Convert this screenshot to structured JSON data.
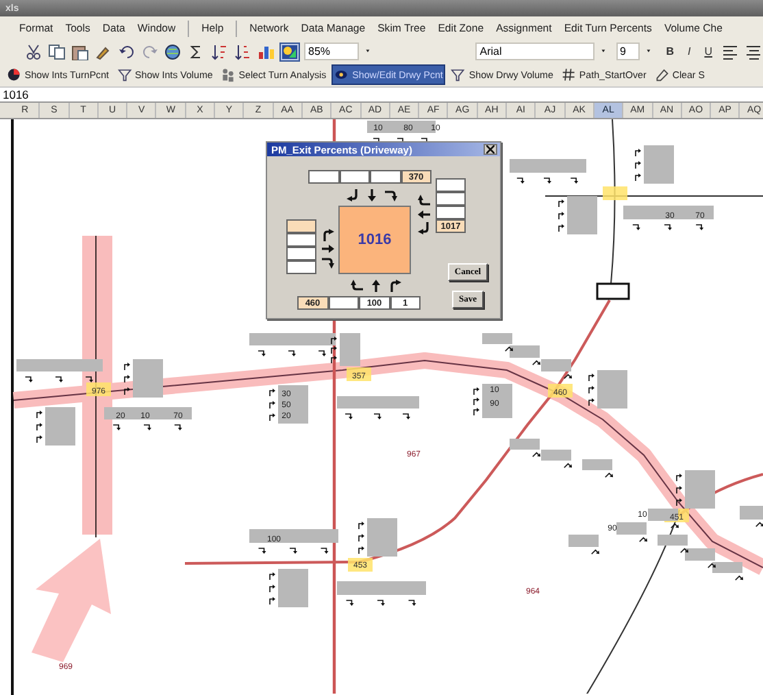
{
  "window": {
    "title": "xls"
  },
  "menu": [
    "Format",
    "Tools",
    "Data",
    "Window",
    "Help",
    "Network",
    "Data Manage",
    "Skim Tree",
    "Edit Zone",
    "Assignment",
    "Edit Turn Percents",
    "Volume Che"
  ],
  "toolbar": {
    "zoom": "85%",
    "font": "Arial",
    "font_size": "9",
    "format_buttons": [
      "B",
      "I",
      "U"
    ]
  },
  "custom_toolbar": [
    {
      "label": "Show Ints TurnPcnt",
      "selected": false
    },
    {
      "label": "Show Ints Volume",
      "selected": false
    },
    {
      "label": "Select Turn Analysis",
      "selected": false
    },
    {
      "label": "Show/Edit Drwy Pcnt",
      "selected": true
    },
    {
      "label": "Show Drwy Volume",
      "selected": false
    },
    {
      "label": "Path_StartOver",
      "selected": false
    },
    {
      "label": "Clear S",
      "selected": false
    }
  ],
  "formula_bar": {
    "value": "1016"
  },
  "columns": [
    {
      "label": "R",
      "selected": false
    },
    {
      "label": "S",
      "selected": false
    },
    {
      "label": "T",
      "selected": false
    },
    {
      "label": "U",
      "selected": false
    },
    {
      "label": "V",
      "selected": false
    },
    {
      "label": "W",
      "selected": false
    },
    {
      "label": "X",
      "selected": false
    },
    {
      "label": "Y",
      "selected": false
    },
    {
      "label": "Z",
      "selected": false
    },
    {
      "label": "AA",
      "selected": false
    },
    {
      "label": "AB",
      "selected": false
    },
    {
      "label": "AC",
      "selected": false
    },
    {
      "label": "AD",
      "selected": false
    },
    {
      "label": "AE",
      "selected": false
    },
    {
      "label": "AF",
      "selected": false
    },
    {
      "label": "AG",
      "selected": false
    },
    {
      "label": "AH",
      "selected": false
    },
    {
      "label": "AI",
      "selected": false
    },
    {
      "label": "AJ",
      "selected": false
    },
    {
      "label": "AK",
      "selected": false
    },
    {
      "label": "AL",
      "selected": true
    },
    {
      "label": "AM",
      "selected": false
    },
    {
      "label": "AN",
      "selected": false
    },
    {
      "label": "AO",
      "selected": false
    },
    {
      "label": "AP",
      "selected": false
    },
    {
      "label": "AQ",
      "selected": false
    }
  ],
  "dialog": {
    "title": "PM_Exit Percents (Driveway)",
    "center_value": "1016",
    "top_fields": [
      {
        "tinted": false
      },
      {
        "tinted": false
      },
      {
        "tinted": false
      },
      {
        "tinted": true,
        "value": "370"
      }
    ],
    "left_fields": [
      {
        "tinted": true
      },
      {
        "tinted": false
      },
      {
        "tinted": false
      },
      {
        "tinted": false
      }
    ],
    "right_fields": [
      {
        "tinted": false
      },
      {
        "tinted": false
      },
      {
        "tinted": false
      },
      {
        "tinted": true,
        "value": "1017"
      }
    ],
    "bottom_fields": [
      {
        "tinted": true,
        "value": "460"
      },
      {
        "tinted": false
      },
      {
        "tinted": false,
        "value": "100"
      },
      {
        "tinted": false,
        "value": "1"
      }
    ],
    "buttons": [
      "Cancel",
      "Save"
    ]
  },
  "map": {
    "intersections": [
      "976",
      "357",
      "460",
      "451",
      "453"
    ],
    "volumes": [
      "10",
      "80",
      "10",
      "20",
      "10",
      "70",
      "30",
      "50",
      "20",
      "10",
      "90",
      "100",
      "30",
      "70",
      "10",
      "90"
    ],
    "zones": [
      "967",
      "964",
      "969"
    ]
  }
}
